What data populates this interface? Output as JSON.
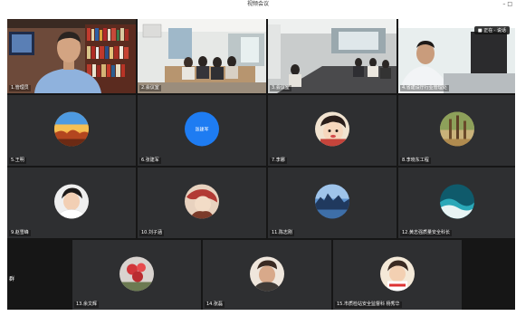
{
  "window": {
    "title": "视频会议",
    "controls": "– □"
  },
  "side_label": "群",
  "video_tiles": [
    {
      "name": "1.管理员"
    },
    {
      "name": "2.会议室"
    },
    {
      "name": "3.会议室"
    },
    {
      "name": "4.省建设厅行业管理处"
    }
  ],
  "video_popup": "■ 正在 · 说话",
  "avatar_rows": [
    [
      {
        "name": "5.王明",
        "avatar": "sunset-avatar"
      },
      {
        "name": "6.张建军",
        "avatar": "blue-badge-avatar",
        "badge": "张建军"
      },
      {
        "name": "7.李娜",
        "avatar": "cartoon-avatar"
      },
      {
        "name": "8.李晓东工程",
        "avatar": "tree-avatar"
      }
    ],
    [
      {
        "name": "9.赵雪峰",
        "avatar": "portrait-avatar"
      },
      {
        "name": "10.刘子涵",
        "avatar": "painting-avatar"
      },
      {
        "name": "11.陈志刚",
        "avatar": "city-avatar"
      },
      {
        "name": "12.黄志强质量安全科长",
        "avatar": "wave-avatar"
      }
    ]
  ],
  "bottom_row": [
    {
      "name": "13.余文辉",
      "avatar": "flower-avatar"
    },
    {
      "name": "14.张磊",
      "avatar": "man-avatar"
    },
    {
      "name": "15.市质检站安全监督科 杨秀华",
      "avatar": "child-avatar"
    }
  ],
  "colors": {
    "tile_bg": "#2e2f31",
    "grid_bg": "#161616",
    "badge_blue": "#1e7cf2"
  }
}
